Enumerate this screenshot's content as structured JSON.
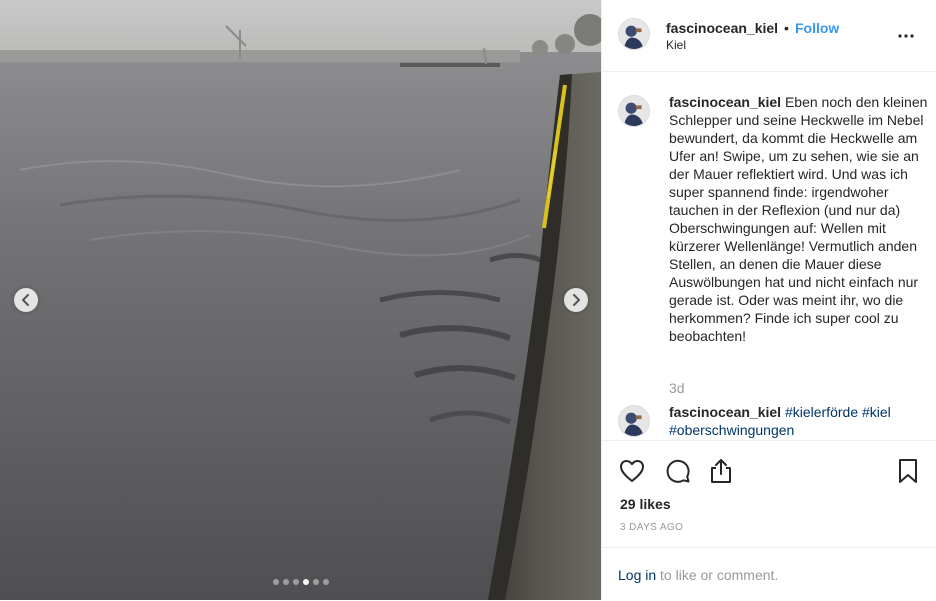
{
  "author": {
    "username": "fascinocean_kiel",
    "location": "Kiel",
    "follow_label": "Follow",
    "separator": "•"
  },
  "caption": {
    "username": "fascinocean_kiel",
    "text": "Eben noch den kleinen Schlepper und seine Heckwelle im Nebel bewundert, da kommt die Heckwelle am Ufer an! Swipe, um zu sehen, wie sie an der Mauer reflektiert wird. Und was ich super spannend finde: irgendwoher tauchen in der Reflexion (und nur da) Oberschwingungen auf: Wellen mit kürzerer Wellenlänge! Vermutlich anden Stellen, an denen die Mauer diese Auswölbungen hat und nicht einfach nur gerade ist. Oder was meint ihr, wo die herkommen? Finde ich super cool zu beobachten!",
    "time": "3d"
  },
  "comment2": {
    "username": "fascinocean_kiel",
    "hashtags": [
      "#kielerförde",
      "#kiel",
      "#oberschwingungen"
    ]
  },
  "media": {
    "slide_count": 6,
    "active_slide": 4
  },
  "stats": {
    "likes": "29 likes",
    "date": "3 DAYS AGO"
  },
  "login": {
    "link": "Log in",
    "rest": " to like or comment."
  },
  "icons": {
    "prev": "chevron-left-icon",
    "next": "chevron-right-icon",
    "more": "more-options-icon",
    "like": "heart-icon",
    "comment": "comment-icon",
    "share": "share-icon",
    "save": "bookmark-icon"
  },
  "colors": {
    "link": "#003569",
    "follow": "#3897f0",
    "muted": "#999999",
    "border": "#efefef"
  }
}
